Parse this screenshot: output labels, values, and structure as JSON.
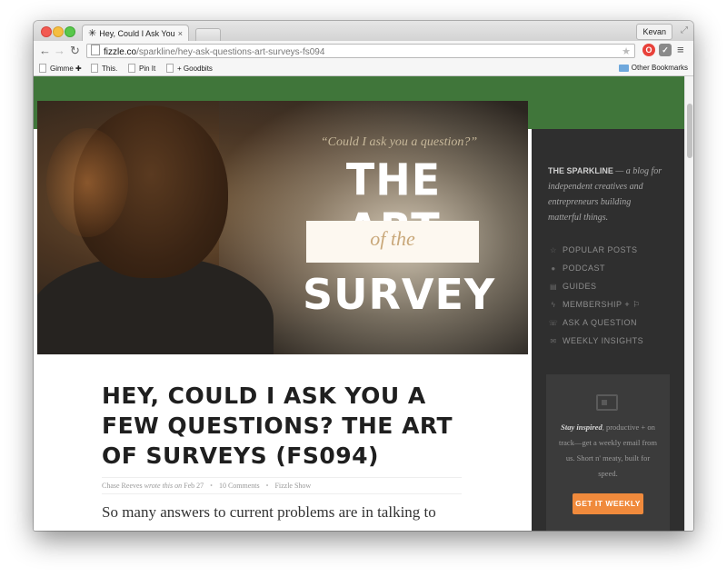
{
  "browser": {
    "tab_title": "Hey, Could I Ask You a Few",
    "tab_close": "×",
    "profile_name": "Kevan",
    "url_domain": "fizzle.co",
    "url_path": "/sparkline/hey-ask-questions-art-surveys-fs094",
    "bookmarks": [
      "Gimme ✚",
      "This.",
      "Pin It",
      "+ Goodbits"
    ],
    "other_bookmarks": "Other Bookmarks"
  },
  "hero": {
    "quote": "“Could I ask you a question?”",
    "line1": "THE ART",
    "line2": "of the",
    "line3": "SURVEY"
  },
  "post": {
    "title": "HEY, COULD I ASK YOU A FEW QUESTIONS? THE ART OF SURVEYS (FS094)",
    "author": "Chase Reeves",
    "wrote_this_on": "wrote this on",
    "date": "Feb 27",
    "comments": "10 Comments",
    "category": "Fizzle Show",
    "excerpt": "So many answers to current problems are in talking to"
  },
  "sidebar": {
    "brand": "THE SPARKLINE",
    "tagline": " — a blog for independent creatives and entrepreneurs building matterful things.",
    "nav": [
      {
        "label": "POPULAR POSTS",
        "icon": "star-icon"
      },
      {
        "label": "PODCAST",
        "icon": "microphone-icon"
      },
      {
        "label": "GUIDES",
        "icon": "book-icon"
      },
      {
        "label": "MEMBERSHIP + ⚐",
        "icon": "bolt-icon"
      },
      {
        "label": "ASK A QUESTION",
        "icon": "phone-icon"
      },
      {
        "label": "WEEKLY INSIGHTS",
        "icon": "envelope-icon"
      }
    ],
    "signup": {
      "bold": "Stay inspired",
      "text": ", productive + on track—get a weekly email from us. Short n' meaty, built for speed.",
      "button": "GET IT WEEKLY"
    }
  },
  "colors": {
    "green_band": "#40763a",
    "sidebar_bg": "#2f2f2f",
    "cta": "#f08a3c"
  }
}
